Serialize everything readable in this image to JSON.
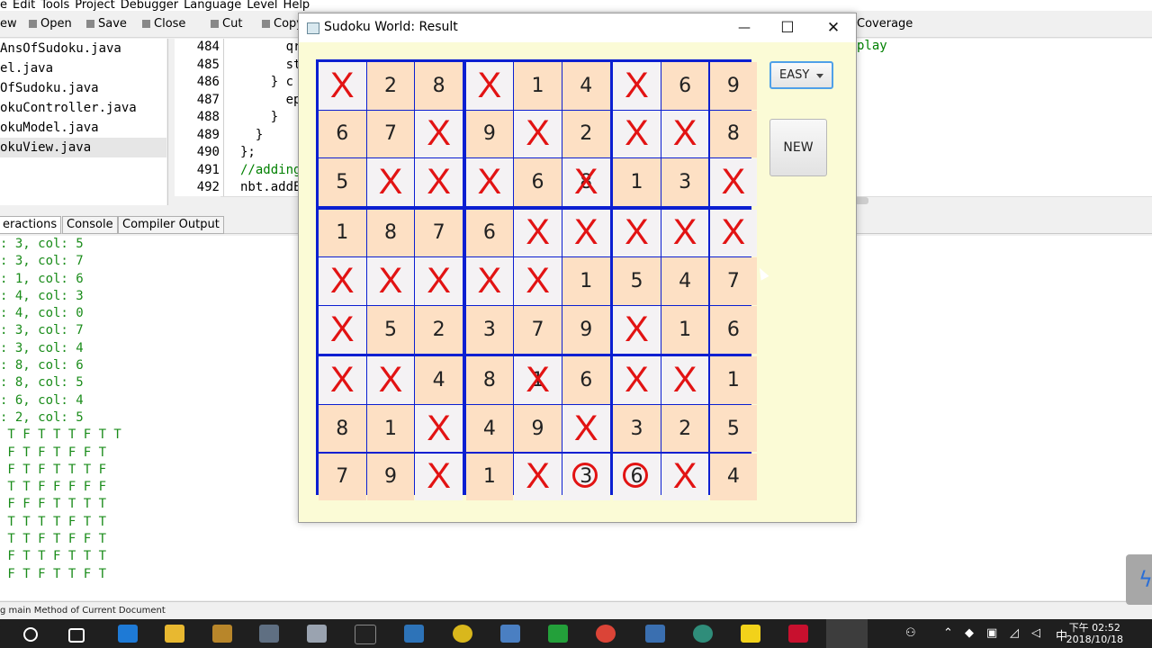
{
  "ide": {
    "menu": [
      "e",
      "Edit",
      "Tools",
      "Project",
      "Debugger",
      "Language",
      "Level",
      "Help"
    ],
    "toolbar": [
      "ew",
      "Open",
      "Save",
      "Close",
      "Cut",
      "Copy"
    ],
    "coverage_label": "Coverage",
    "files": [
      "AnsOfSudoku.java",
      "el.java",
      "OfSudoku.java",
      "okuController.java",
      "okuModel.java",
      "okuView.java"
    ],
    "selected_file_index": 5,
    "line_numbers": [
      "484",
      "485",
      "486",
      "487",
      "488",
      "489",
      "490",
      "491",
      "492"
    ],
    "code_lines": [
      "      qr",
      "      st",
      "    } c",
      "      ep",
      "    }",
      "  }",
      "};",
      "//adding",
      "nbt.addE"
    ],
    "code_right": "play",
    "tabs": [
      "eractions",
      "Console",
      "Compiler Output"
    ],
    "console_lines": [
      ": 3, col: 5",
      ": 3, col: 7",
      ": 1, col: 6",
      ": 4, col: 3",
      ": 4, col: 0",
      ": 3, col: 7",
      ": 3, col: 4",
      ": 8, col: 6",
      ": 8, col: 5",
      ": 6, col: 4",
      ": 2, col: 5",
      " T F T T T F T T",
      " F T F T F F T",
      " F T F T T T F",
      " T T F F F F F",
      " F F F T T T T",
      " T T T T F T T",
      " T T F T F F T",
      " F T T F T T T",
      " F T F T T F T"
    ],
    "status": "g main Method of Current Document"
  },
  "window": {
    "title": "Sudoku World: Result",
    "minimize": "—",
    "maximize": "☐",
    "close": "✕"
  },
  "controls": {
    "difficulty": "EASY",
    "new_button": "NEW"
  },
  "board": {
    "rows": [
      [
        "X",
        "2",
        "8",
        "X",
        "1",
        "4",
        "X",
        "6",
        "9"
      ],
      [
        "6",
        "7",
        "X",
        "9",
        "X",
        "2",
        "X",
        "X",
        "8"
      ],
      [
        "5",
        "X",
        "X",
        "X",
        "6",
        "X8",
        "1",
        "3",
        "X"
      ],
      [
        "1",
        "8",
        "7",
        "6",
        "X",
        "X",
        "X",
        "X",
        "X"
      ],
      [
        "X",
        "X",
        "X",
        "X",
        "X",
        "1",
        "5",
        "4",
        "7"
      ],
      [
        "X",
        "5",
        "2",
        "3",
        "7",
        "9",
        "X",
        "1",
        "6"
      ],
      [
        "X",
        "X",
        "4",
        "8",
        "X1",
        "6",
        "X",
        "X",
        "1"
      ],
      [
        "8",
        "1",
        "X",
        "4",
        "9",
        "X",
        "3",
        "2",
        "5"
      ],
      [
        "7",
        "9",
        "X",
        "1",
        "X",
        "O3",
        "O6",
        "X",
        "4"
      ]
    ],
    "cell_shading": [
      [
        "w",
        "p",
        "p",
        "w",
        "p",
        "p",
        "w",
        "p",
        "p"
      ],
      [
        "p",
        "p",
        "w",
        "p",
        "w",
        "p",
        "w",
        "w",
        "p"
      ],
      [
        "p",
        "w",
        "w",
        "w",
        "p",
        "w",
        "p",
        "p",
        "w"
      ],
      [
        "p",
        "p",
        "p",
        "p",
        "w",
        "w",
        "w",
        "w",
        "w"
      ],
      [
        "w",
        "w",
        "w",
        "w",
        "w",
        "p",
        "p",
        "p",
        "p"
      ],
      [
        "w",
        "p",
        "p",
        "p",
        "p",
        "p",
        "w",
        "p",
        "p"
      ],
      [
        "w",
        "w",
        "p",
        "p",
        "w",
        "p",
        "w",
        "w",
        "p"
      ],
      [
        "p",
        "p",
        "w",
        "p",
        "p",
        "w",
        "p",
        "p",
        "p"
      ],
      [
        "p",
        "p",
        "w",
        "p",
        "w",
        "w",
        "w",
        "w",
        "p"
      ]
    ],
    "colors": {
      "grid": "#0b1fd1",
      "mark": "#e21313",
      "given": "#fde0c4",
      "blank": "#f4f2f4"
    }
  },
  "taskbar": {
    "clock_time": "下午 02:52",
    "clock_date": "2018/10/18",
    "ime": "中"
  }
}
